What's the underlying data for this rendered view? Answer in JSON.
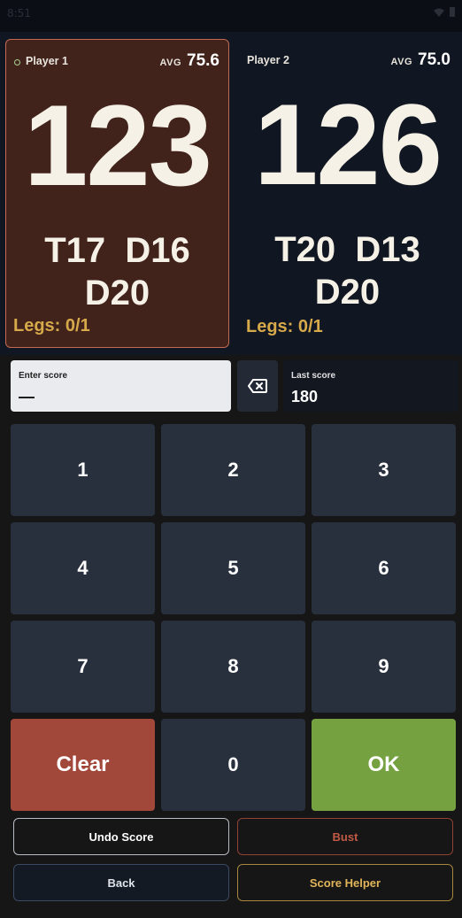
{
  "status_bar": {
    "time": "8:51",
    "icons": [
      "notification-icon",
      "wifi-icon",
      "battery-icon"
    ]
  },
  "players": [
    {
      "name": "Player 1",
      "active": true,
      "avg_label": "AVG",
      "avg": "75.6",
      "score": "123",
      "checkout_line1": "T17  D16",
      "checkout_line2": "D20",
      "legs": "Legs: 0/1"
    },
    {
      "name": "Player 2",
      "active": false,
      "avg_label": "AVG",
      "avg": "75.0",
      "score": "126",
      "checkout_line1": "T20  D13",
      "checkout_line2": "D20",
      "legs": "Legs: 0/1"
    }
  ],
  "entry": {
    "label": "Enter score",
    "value": "—",
    "backspace_icon": "backspace-icon",
    "last_label": "Last score",
    "last_value": "180"
  },
  "keypad": {
    "keys": [
      "1",
      "2",
      "3",
      "4",
      "5",
      "6",
      "7",
      "8",
      "9"
    ],
    "clear": "Clear",
    "zero": "0",
    "ok": "OK"
  },
  "actions": {
    "undo": "Undo Score",
    "bust": "Bust",
    "back": "Back",
    "helper": "Score Helper"
  },
  "colors": {
    "active_card": "#41231c",
    "active_border": "#c46a52",
    "legs": "#d6a94a",
    "clear": "#a2483a",
    "ok": "#76a140",
    "key": "#28303e"
  }
}
